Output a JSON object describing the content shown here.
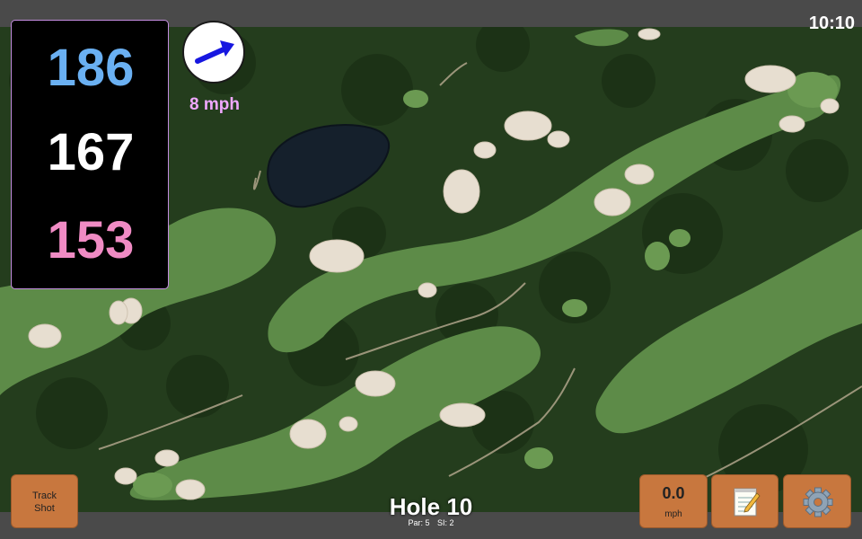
{
  "status": {
    "clock": "10:10"
  },
  "yardages": {
    "back": "186",
    "center": "167",
    "front": "153"
  },
  "wind": {
    "speed": "8 mph",
    "direction_icon": "wind-arrow-icon"
  },
  "hole": {
    "title": "Hole 10",
    "par": "Par: 5",
    "stroke_index": "SI: 2"
  },
  "buttons": {
    "track_shot_line1": "Track",
    "track_shot_line2": "Shot",
    "speed_value": "0.0",
    "speed_unit": "mph",
    "notes_icon": "notepad-icon",
    "settings_icon": "gear-icon"
  },
  "colors": {
    "back_yardage": "#6ab0f2",
    "center_yardage": "#ffffff",
    "front_yardage": "#f08bc4",
    "button": "#c8773e",
    "wind_text": "#f0a8ff"
  }
}
